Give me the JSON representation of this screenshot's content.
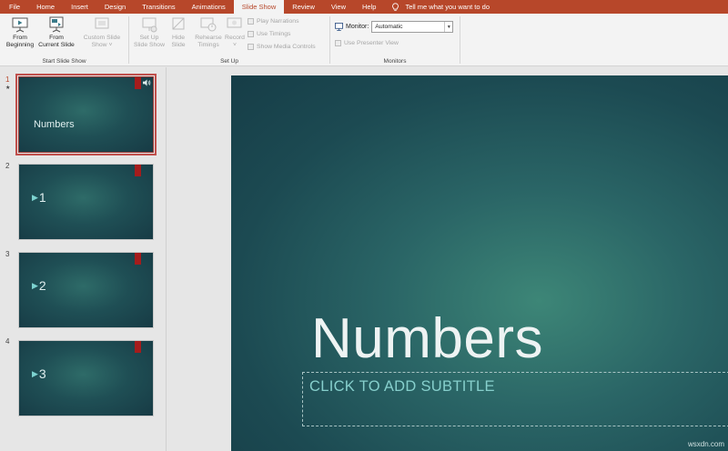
{
  "tabs": [
    "File",
    "Home",
    "Insert",
    "Design",
    "Transitions",
    "Animations",
    "Slide Show",
    "Review",
    "View",
    "Help"
  ],
  "active_tab": "Slide Show",
  "tell_me": "Tell me what you want to do",
  "ribbon": {
    "start_group": {
      "label": "Start Slide Show",
      "from_beginning": [
        "From",
        "Beginning"
      ],
      "from_current": [
        "From",
        "Current Slide"
      ],
      "custom": [
        "Custom Slide",
        "Show ˅"
      ]
    },
    "setup_group": {
      "label": "Set Up",
      "setup_show": [
        "Set Up",
        "Slide Show"
      ],
      "hide_slide": [
        "Hide",
        "Slide"
      ],
      "rehearse": [
        "Rehearse",
        "Timings"
      ],
      "record": [
        "Record",
        "˅"
      ],
      "play_narrations": "Play Narrations",
      "use_timings": "Use Timings",
      "show_media": "Show Media Controls"
    },
    "monitors_group": {
      "label": "Monitors",
      "monitor_label": "Monitor:",
      "monitor_value": "Automatic",
      "presenter_view": "Use Presenter View"
    }
  },
  "slides": [
    {
      "num": "1",
      "text": "Numbers",
      "kind": "title"
    },
    {
      "num": "2",
      "text": "1",
      "kind": "bullet"
    },
    {
      "num": "3",
      "text": "2",
      "kind": "bullet"
    },
    {
      "num": "4",
      "text": "3",
      "kind": "bullet"
    }
  ],
  "slide_marker": "★",
  "main_slide": {
    "title": "Numbers",
    "subtitle_placeholder": "CLICK TO ADD SUBTITLE"
  },
  "watermark": "wsxdn.com"
}
